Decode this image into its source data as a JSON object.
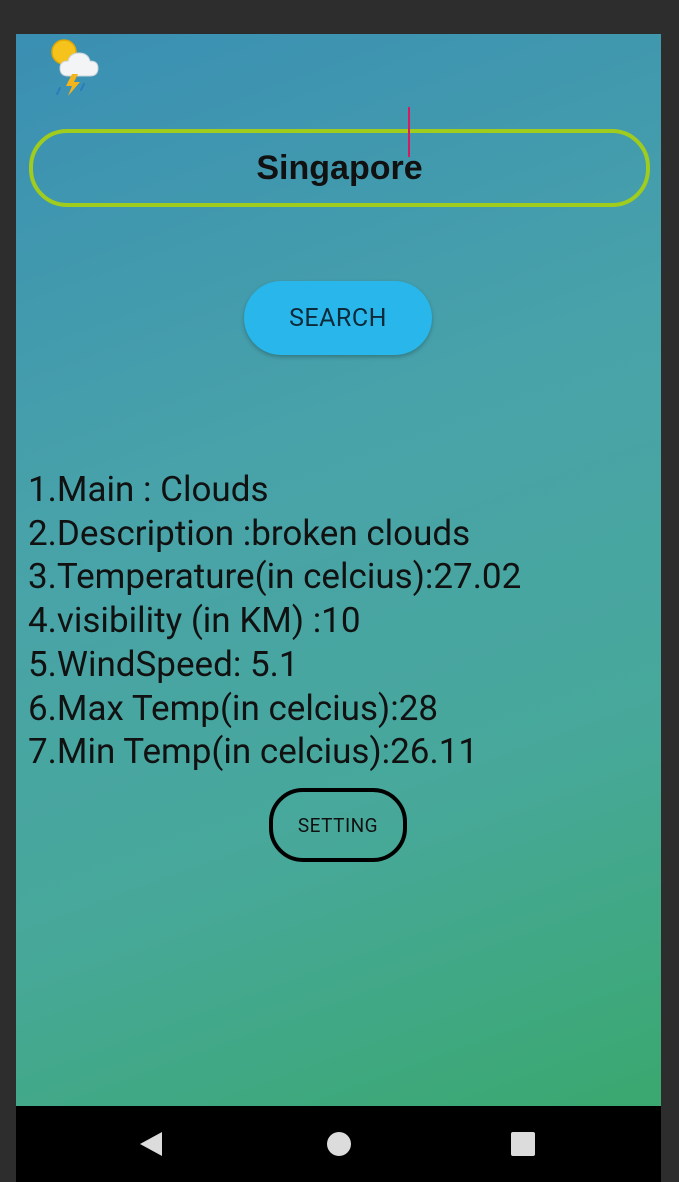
{
  "app": {
    "icon": "weather-storm-icon"
  },
  "search": {
    "value": "Singapore",
    "button_label": "SEARCH"
  },
  "results": [
    "1.Main : Clouds",
    "2.Description :broken clouds",
    "3.Temperature(in celcius):27.02",
    "4.visibility (in KM) :10",
    "5.WindSpeed: 5.1",
    "6.Max Temp(in celcius):28",
    "7.Min Temp(in celcius):26.11"
  ],
  "setting": {
    "button_label": "SETTING"
  },
  "navbar": {
    "back": "back-triangle-icon",
    "home": "home-circle-icon",
    "recent": "recent-apps-square-icon"
  },
  "colors": {
    "input_border": "#a0cc1e",
    "search_button": "#29b6ea",
    "caret": "#d81b60",
    "gradient_top": "#3a8fb3",
    "gradient_bottom": "#3aa86f"
  }
}
